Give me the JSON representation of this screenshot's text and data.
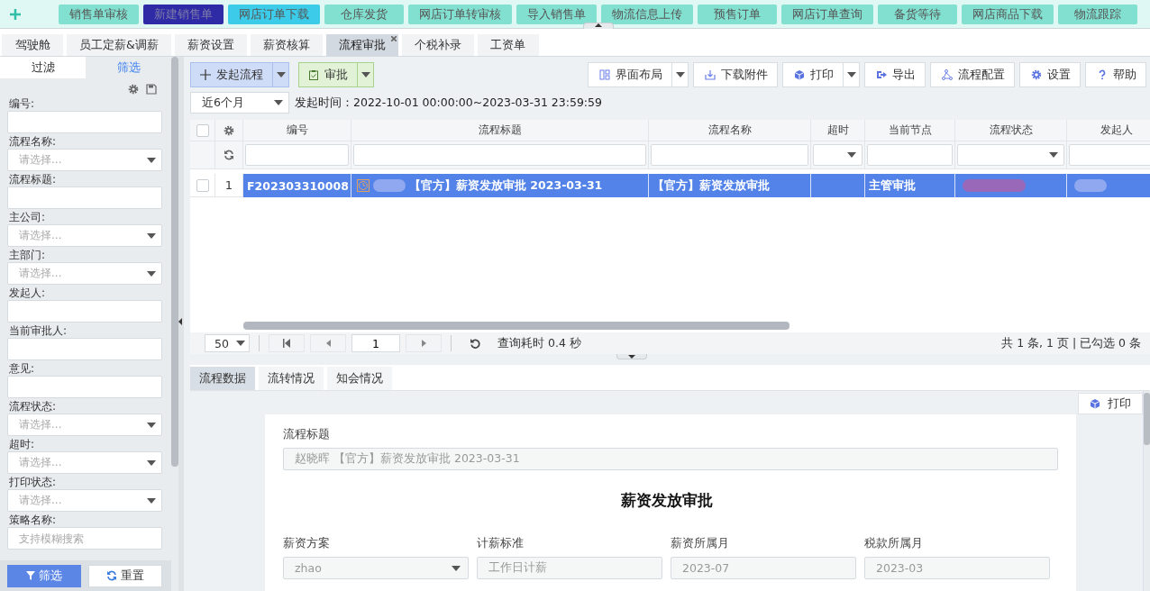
{
  "top_menu": [
    {
      "label": "销售单审核",
      "selected": false,
      "hovered": false
    },
    {
      "label": "新建销售单",
      "selected": true,
      "hovered": false
    },
    {
      "label": "网店订单下载",
      "selected": false,
      "hovered": true
    },
    {
      "label": "仓库发货",
      "selected": false,
      "hovered": false
    },
    {
      "label": "网店订单转审核",
      "selected": false,
      "hovered": false
    },
    {
      "label": "导入销售单",
      "selected": false,
      "hovered": false
    },
    {
      "label": "物流信息上传",
      "selected": false,
      "hovered": false
    },
    {
      "label": "预售订单",
      "selected": false,
      "hovered": false
    },
    {
      "label": "网店订单查询",
      "selected": false,
      "hovered": false
    },
    {
      "label": "备货等待",
      "selected": false,
      "hovered": false
    },
    {
      "label": "网店商品下载",
      "selected": false,
      "hovered": false
    },
    {
      "label": "物流跟踪",
      "selected": false,
      "hovered": false
    }
  ],
  "tabs": [
    {
      "label": "驾驶舱",
      "selected": false
    },
    {
      "label": "员工定薪&调薪",
      "selected": false
    },
    {
      "label": "薪资设置",
      "selected": false
    },
    {
      "label": "薪资核算",
      "selected": false
    },
    {
      "label": "流程审批",
      "selected": true
    },
    {
      "label": "个税补录",
      "selected": false
    },
    {
      "label": "工资单",
      "selected": false
    }
  ],
  "sidebar": {
    "tabs": [
      {
        "label": "过滤",
        "selected": false
      },
      {
        "label": "筛选",
        "selected": true
      }
    ],
    "fields": [
      {
        "label": "编号:",
        "kind": "text"
      },
      {
        "label": "流程名称:",
        "kind": "select",
        "placeholder": "请选择..."
      },
      {
        "label": "流程标题:",
        "kind": "text"
      },
      {
        "label": "主公司:",
        "kind": "select",
        "placeholder": "请选择..."
      },
      {
        "label": "主部门:",
        "kind": "select",
        "placeholder": "请选择..."
      },
      {
        "label": "发起人:",
        "kind": "text"
      },
      {
        "label": "当前审批人:",
        "kind": "text"
      },
      {
        "label": "意见:",
        "kind": "text"
      },
      {
        "label": "流程状态:",
        "kind": "select",
        "placeholder": "请选择..."
      },
      {
        "label": "超时:",
        "kind": "select",
        "placeholder": "请选择..."
      },
      {
        "label": "打印状态:",
        "kind": "select",
        "placeholder": "请选择..."
      },
      {
        "label": "策略名称:",
        "kind": "text",
        "placeholder": "支持模糊搜索"
      }
    ],
    "buttons": [
      {
        "label": "筛选",
        "kind": "primary"
      },
      {
        "label": "重置",
        "kind": "default"
      }
    ]
  },
  "toolbar": {
    "left": [
      {
        "label": "发起流程",
        "kind": "start"
      },
      {
        "label": "审批",
        "kind": "approve"
      }
    ],
    "right": [
      {
        "label": "界面布局",
        "kind": "layout",
        "dropdown": true
      },
      {
        "label": "下载附件",
        "kind": "download",
        "dropdown": false
      },
      {
        "label": "打印",
        "kind": "print",
        "dropdown": true
      },
      {
        "label": "导出",
        "kind": "export",
        "dropdown": false
      },
      {
        "label": "流程配置",
        "kind": "flow",
        "dropdown": false
      },
      {
        "label": "设置",
        "kind": "settings",
        "dropdown": false
      },
      {
        "label": "帮助",
        "kind": "help",
        "dropdown": false
      }
    ]
  },
  "date_filter": {
    "value": "近6个月",
    "label": "发起时间：2022-10-01 00:00:00~2023-03-31 23:59:59"
  },
  "table": {
    "all_checked": false,
    "columns": [
      {
        "label": "编号",
        "kind": "text"
      },
      {
        "label": "流程标题",
        "kind": "text"
      },
      {
        "label": "流程名称",
        "kind": "text"
      },
      {
        "label": "超时",
        "kind": "select"
      },
      {
        "label": "当前节点",
        "kind": "text"
      },
      {
        "label": "流程状态",
        "kind": "select"
      },
      {
        "label": "发起人",
        "kind": "text"
      }
    ],
    "rows": [
      {
        "index": "1",
        "selected": true,
        "checked": false,
        "cells": [
          {
            "text": "F202303310008"
          },
          {
            "text": "【官方】薪资发放审批 2023-03-31",
            "icon": true,
            "blurred": true
          },
          {
            "text": "【官方】薪资发放审批"
          },
          {},
          {
            "text": "主管审批"
          },
          {
            "blurred": true
          },
          {
            "blurred": true
          }
        ]
      }
    ]
  },
  "pager": {
    "page_size": "50",
    "page": "1",
    "timing": "查询耗时 0.4 秒",
    "summary": "共 1 条, 1 页 | 已勾选 0 条"
  },
  "detail": {
    "tabs": [
      {
        "label": "流程数据",
        "selected": true
      },
      {
        "label": "流转情况",
        "selected": false
      },
      {
        "label": "知会情况",
        "selected": false
      }
    ],
    "print": "打印",
    "title_label": "流程标题",
    "title_value": "赵晓晖 【官方】薪资发放审批 2023-03-31",
    "heading": "薪资发放审批",
    "fields": [
      {
        "label": "薪资方案",
        "value": "zhao",
        "kind": "select"
      },
      {
        "label": "计薪标准",
        "value": "工作日计薪",
        "kind": "text"
      },
      {
        "label": "薪资所属月",
        "value": "2023-07",
        "kind": "text"
      },
      {
        "label": "税款所属月",
        "value": "2023-03",
        "kind": "text"
      }
    ]
  }
}
